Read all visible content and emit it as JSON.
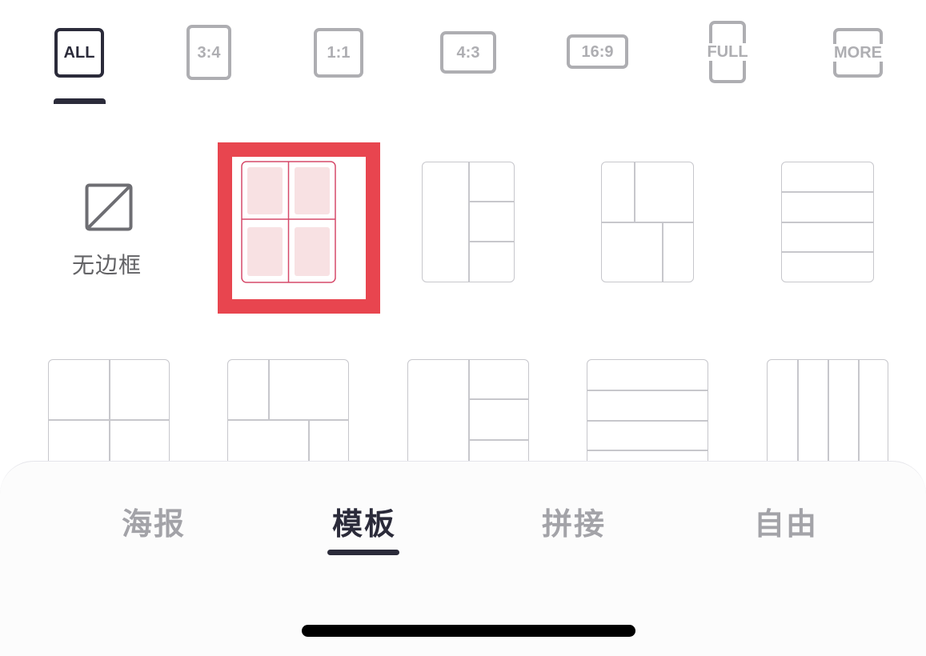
{
  "ratio_filters": [
    {
      "label": "ALL",
      "active": true
    },
    {
      "label": "3:4",
      "active": false
    },
    {
      "label": "1:1",
      "active": false
    },
    {
      "label": "4:3",
      "active": false
    },
    {
      "label": "16:9",
      "active": false
    },
    {
      "label": "FULL",
      "active": false
    },
    {
      "label": "MORE",
      "active": false
    }
  ],
  "templates": {
    "no_border_label": "无边框",
    "selected_index": 1,
    "accent_color": "#e8454f"
  },
  "bottom_tabs": [
    {
      "label": "海报",
      "active": false
    },
    {
      "label": "模板",
      "active": true
    },
    {
      "label": "拼接",
      "active": false
    },
    {
      "label": "自由",
      "active": false
    }
  ],
  "colors": {
    "active": "#2b2b3a",
    "inactive": "#aeaeb2",
    "highlight": "#e8454f",
    "cell_fill": "#f8e1e3"
  }
}
